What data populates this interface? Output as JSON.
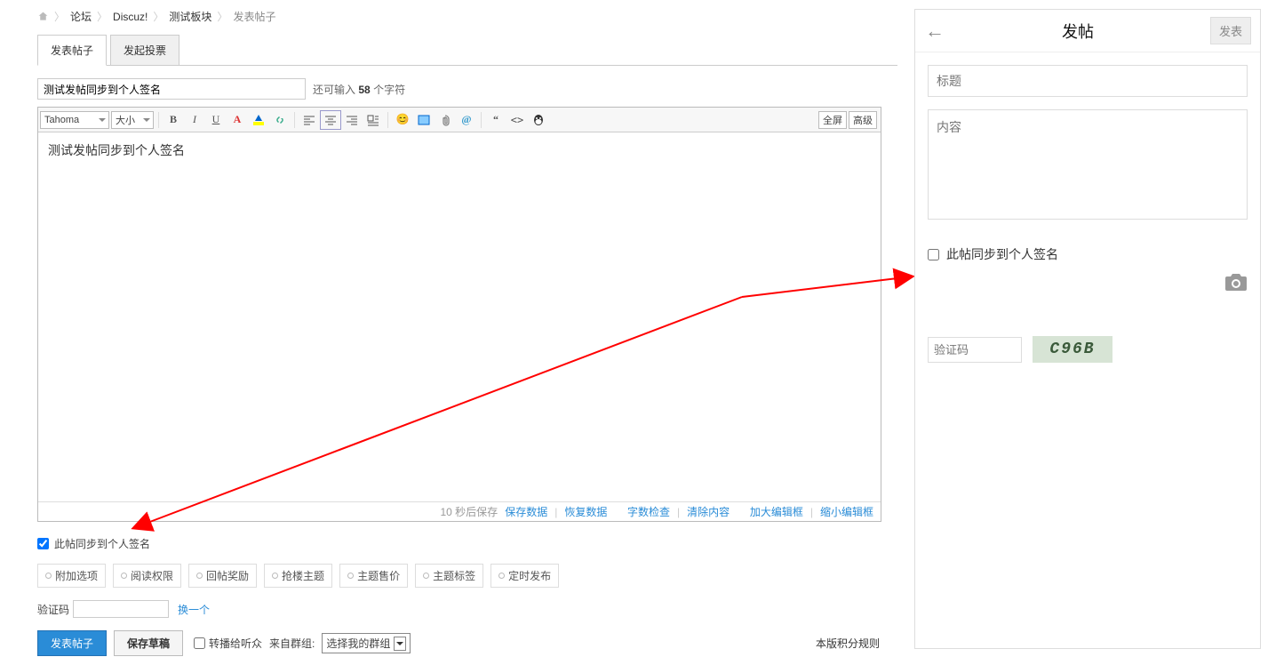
{
  "breadcrumb": {
    "home": "⌂",
    "items": [
      "论坛",
      "Discuz!",
      "测试板块",
      "发表帖子"
    ]
  },
  "tabs": [
    {
      "label": "发表帖子",
      "active": true
    },
    {
      "label": "发起投票",
      "active": false
    }
  ],
  "title": {
    "value": "测试发帖同步到个人签名",
    "remain_pre": "还可输入",
    "remain_count": "58",
    "remain_suf": "个字符"
  },
  "toolbar": {
    "font": "Tahoma",
    "size": "大小",
    "fullscreen": "全屏",
    "advanced": "高级"
  },
  "editor": {
    "content": "测试发帖同步到个人签名"
  },
  "footer": {
    "autosave": "10 秒后保存",
    "save": "保存数据",
    "restore": "恢复数据",
    "wordcheck": "字数检查",
    "clear": "清除内容",
    "enlarge": "加大编辑框",
    "shrink": "缩小编辑框"
  },
  "sync": {
    "label": "此帖同步到个人签名",
    "checked": true
  },
  "options": [
    "附加选项",
    "阅读权限",
    "回帖奖励",
    "抢楼主题",
    "主题售价",
    "主题标签",
    "定时发布"
  ],
  "verify": {
    "label": "验证码",
    "change": "换一个"
  },
  "submit": {
    "post": "发表帖子",
    "draft": "保存草稿",
    "broadcast": "转播给听众",
    "group_label": "来自群组:",
    "group_value": "选择我的群组",
    "rules": "本版积分规则"
  },
  "mobile": {
    "title": "发帖",
    "publish": "发表",
    "title_ph": "标题",
    "content_ph": "内容",
    "sync_label": "此帖同步到个人签名",
    "verify_ph": "验证码",
    "captcha": "C96B"
  }
}
